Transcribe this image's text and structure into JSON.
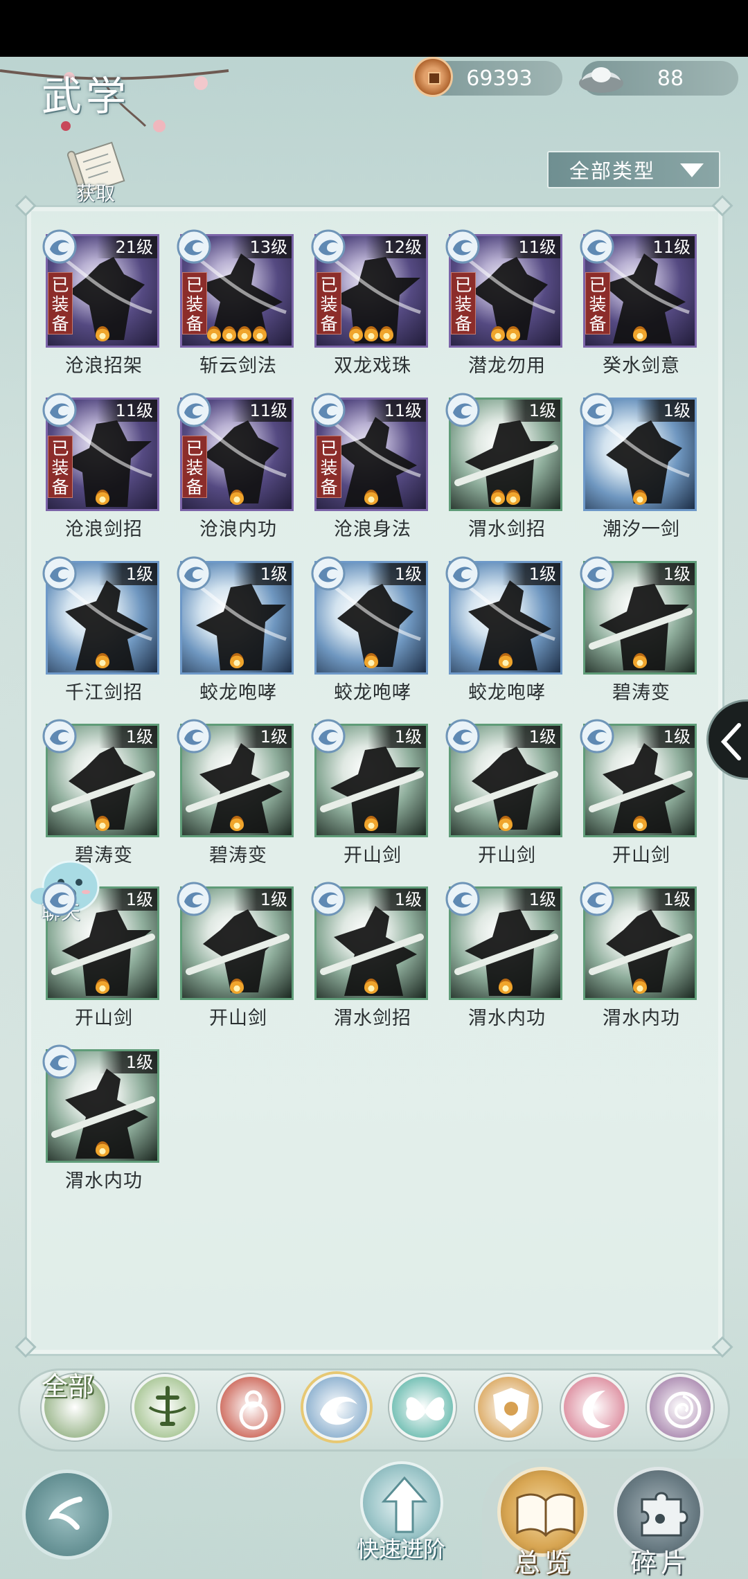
{
  "header": {
    "title": "武学"
  },
  "currency": {
    "coins": "69393",
    "silver": "88"
  },
  "acquire_label": "获取",
  "filter": {
    "selected": "全部类型"
  },
  "colors": {
    "equipped_badge": "#8c2d2a",
    "rare_border": "#7b64a8",
    "blue_border": "#6d98c8",
    "green_border": "#5f9c78"
  },
  "skills": [
    {
      "name": "沧浪招架",
      "rank": "21级",
      "equipped": "已装备",
      "tier": "purple",
      "flames": 1
    },
    {
      "name": "斩云剑法",
      "rank": "13级",
      "equipped": "已装备",
      "tier": "purple",
      "flames": 4
    },
    {
      "name": "双龙戏珠",
      "rank": "12级",
      "equipped": "已装备",
      "tier": "purple",
      "flames": 3
    },
    {
      "name": "潜龙勿用",
      "rank": "11级",
      "equipped": "已装备",
      "tier": "purple",
      "flames": 2
    },
    {
      "name": "癸水剑意",
      "rank": "11级",
      "equipped": "已装备",
      "tier": "purple",
      "flames": 1
    },
    {
      "name": "沧浪剑招",
      "rank": "11级",
      "equipped": "已装备",
      "tier": "purple",
      "flames": 1
    },
    {
      "name": "沧浪内功",
      "rank": "11级",
      "equipped": "已装备",
      "tier": "purple",
      "flames": 1
    },
    {
      "name": "沧浪身法",
      "rank": "11级",
      "equipped": "已装备",
      "tier": "purple",
      "flames": 1
    },
    {
      "name": "渭水剑招",
      "rank": "1级",
      "equipped": "",
      "tier": "green",
      "flames": 2
    },
    {
      "name": "潮汐一剑",
      "rank": "1级",
      "equipped": "",
      "tier": "blue",
      "flames": 1
    },
    {
      "name": "千江剑招",
      "rank": "1级",
      "equipped": "",
      "tier": "blue",
      "flames": 1
    },
    {
      "name": "蛟龙咆哮",
      "rank": "1级",
      "equipped": "",
      "tier": "blue",
      "flames": 1
    },
    {
      "name": "蛟龙咆哮",
      "rank": "1级",
      "equipped": "",
      "tier": "blue",
      "flames": 1
    },
    {
      "name": "蛟龙咆哮",
      "rank": "1级",
      "equipped": "",
      "tier": "blue",
      "flames": 1
    },
    {
      "name": "碧涛变",
      "rank": "1级",
      "equipped": "",
      "tier": "green",
      "flames": 1
    },
    {
      "name": "碧涛变",
      "rank": "1级",
      "equipped": "",
      "tier": "green",
      "flames": 1
    },
    {
      "name": "碧涛变",
      "rank": "1级",
      "equipped": "",
      "tier": "green",
      "flames": 1
    },
    {
      "name": "开山剑",
      "rank": "1级",
      "equipped": "",
      "tier": "green",
      "flames": 1
    },
    {
      "name": "开山剑",
      "rank": "1级",
      "equipped": "",
      "tier": "green",
      "flames": 1
    },
    {
      "name": "开山剑",
      "rank": "1级",
      "equipped": "",
      "tier": "green",
      "flames": 1
    },
    {
      "name": "开山剑",
      "rank": "1级",
      "equipped": "",
      "tier": "green",
      "flames": 1
    },
    {
      "name": "开山剑",
      "rank": "1级",
      "equipped": "",
      "tier": "green",
      "flames": 1
    },
    {
      "name": "渭水剑招",
      "rank": "1级",
      "equipped": "",
      "tier": "green",
      "flames": 1
    },
    {
      "name": "渭水内功",
      "rank": "1级",
      "equipped": "",
      "tier": "green",
      "flames": 1
    },
    {
      "name": "渭水内功",
      "rank": "1级",
      "equipped": "",
      "tier": "green",
      "flames": 1
    },
    {
      "name": "渭水内功",
      "rank": "1级",
      "equipped": "",
      "tier": "green",
      "flames": 1
    }
  ],
  "chat_label": "聊天",
  "school_tabs": [
    {
      "label": "全部",
      "icon": "all-icon",
      "color": "#8fae7e"
    },
    {
      "label": "",
      "icon": "sword-icon",
      "color": "#9fc08a"
    },
    {
      "label": "",
      "icon": "flame-gourd-icon",
      "color": "#c8594a"
    },
    {
      "label": "",
      "icon": "wave-icon",
      "color": "#7fa7c9"
    },
    {
      "label": "",
      "icon": "butterfly-icon",
      "color": "#5fb6a9"
    },
    {
      "label": "",
      "icon": "shield-icon",
      "color": "#d7a052"
    },
    {
      "label": "",
      "icon": "moon-icon",
      "color": "#d98295"
    },
    {
      "label": "",
      "icon": "rose-icon",
      "color": "#a27ea8"
    }
  ],
  "bottom": {
    "advance_label": "快速进阶",
    "overview_label": "总览",
    "fragment_label": "碎片"
  }
}
